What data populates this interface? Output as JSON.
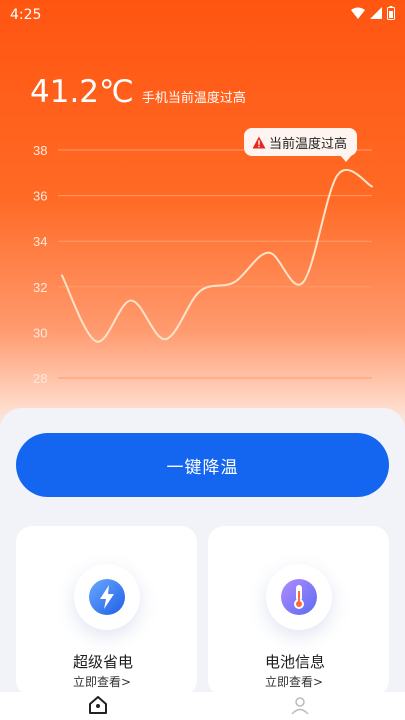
{
  "status_bar": {
    "time": "4:25"
  },
  "header": {
    "temperature": "41.2℃",
    "note": "手机当前温度过高"
  },
  "warning_bubble": {
    "text": "当前温度过高"
  },
  "chart_data": {
    "type": "line",
    "y_ticks": [
      "38",
      "36",
      "34",
      "32",
      "30",
      "28"
    ],
    "ylim": [
      28,
      38
    ],
    "grid": true,
    "series": [
      {
        "values": [
          32.5,
          29.6,
          31.4,
          29.7,
          31.8,
          32.2,
          33.5,
          32.2,
          36.9,
          36.4
        ]
      }
    ],
    "colors": {
      "line": "#ffe3c8",
      "grid": "#ff9c6a"
    }
  },
  "primary_action": {
    "label": "一键降温"
  },
  "cards": [
    {
      "title": "超级省电",
      "subtitle": "立即查看>",
      "icon": "lightning-icon"
    },
    {
      "title": "电池信息",
      "subtitle": "立即查看>",
      "icon": "thermometer-icon"
    }
  ],
  "tabbar": {
    "home_icon": "home-icon",
    "user_icon": "user-icon"
  },
  "colors": {
    "accent": "#1466f0",
    "hero": "#ff5511"
  }
}
